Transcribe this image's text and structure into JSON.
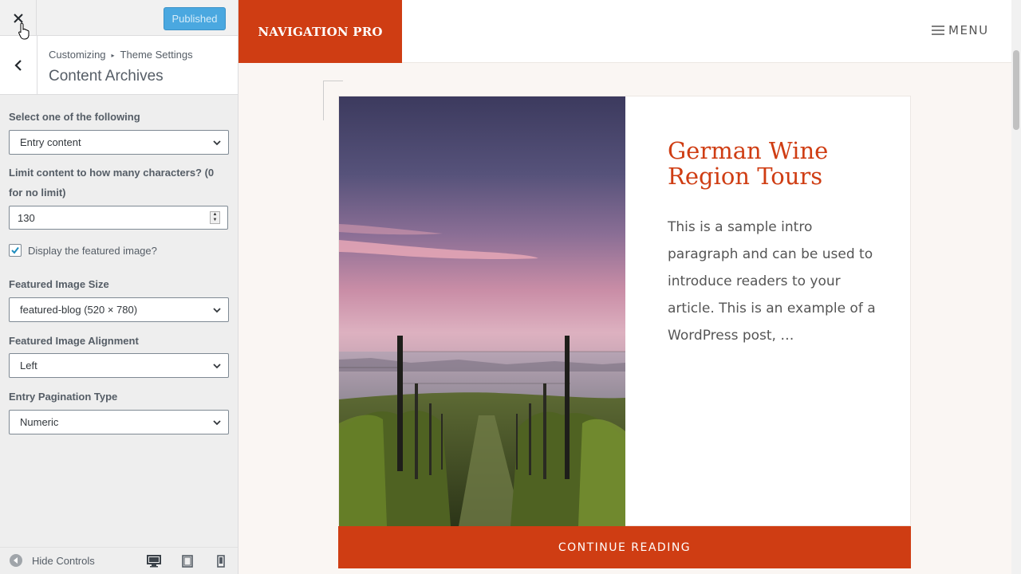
{
  "customizer": {
    "close_icon": "close-icon",
    "publish_label": "Published",
    "breadcrumb": {
      "root": "Customizing",
      "parent": "Theme Settings"
    },
    "section_title": "Content Archives",
    "controls": {
      "display_select": {
        "label": "Select one of the following",
        "value": "Entry content"
      },
      "limit": {
        "label": "Limit content to how many characters? (0 for no limit)",
        "value": "130"
      },
      "featured_image": {
        "label": "Display the featured image?",
        "checked": true
      },
      "image_size": {
        "label": "Featured Image Size",
        "value": "featured-blog (520 × 780)"
      },
      "image_alignment": {
        "label": "Featured Image Alignment",
        "value": "Left"
      },
      "pagination": {
        "label": "Entry Pagination Type",
        "value": "Numeric"
      }
    },
    "footer": {
      "hide_controls": "Hide Controls"
    }
  },
  "preview": {
    "site_title": "NAVIGATION PRO",
    "menu_label": "MENU",
    "post": {
      "title": "German Wine Region Tours",
      "excerpt": "This is a sample intro paragraph and can be used to introduce readers to your article. This is an example of a WordPress post, …",
      "continue_label": "CONTINUE READING"
    }
  },
  "colors": {
    "accent": "#cf3d13",
    "publish": "#4aa8e0"
  }
}
